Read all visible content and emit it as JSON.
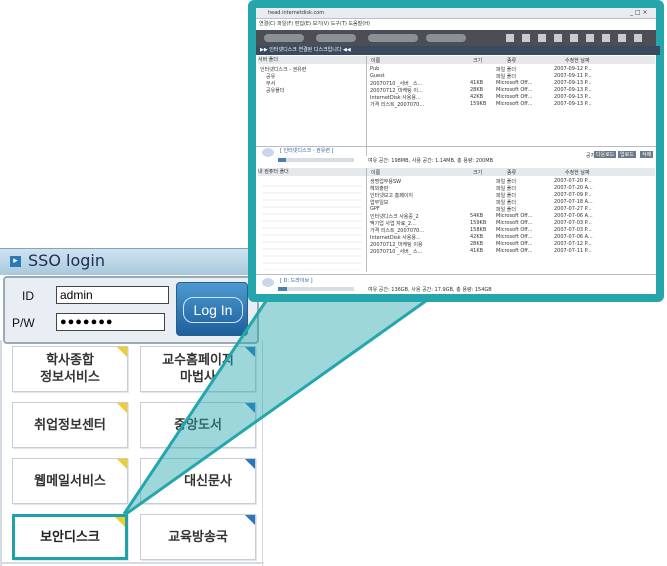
{
  "sso": {
    "title": "SSO login",
    "id_label": "ID",
    "pw_label": "P/W",
    "id_value": "admin",
    "pw_value": "●●●●●●●",
    "login_label": "Log In"
  },
  "tiles": [
    {
      "line1": "학사종합",
      "line2": "정보서비스"
    },
    {
      "line1": "교수홈페이지",
      "line2": "마법사"
    },
    {
      "line1": "취업정보센터",
      "line2": ""
    },
    {
      "line1": "중앙도서",
      "line2": ""
    },
    {
      "line1": "웹메일서비스",
      "line2": ""
    },
    {
      "line1": "대신문사",
      "line2": ""
    },
    {
      "line1": "보안디스크",
      "line2": ""
    },
    {
      "line1": "교육방송국",
      "line2": ""
    }
  ],
  "window": {
    "title": "head.internetdisk.com",
    "menu": "연결(C)  파일(F)  편집(E)  보기(V)  도구(T)  도움말(H)",
    "section_title": "▶▶ 인터넷디스크 연결된 디스크입니다 ◀◀",
    "server_folder": "서버 폴더",
    "col_name": "이름",
    "col_size": "크기",
    "col_type": "종류",
    "col_date": "수정한 날짜",
    "tree_top": [
      "인터넷디스크 - 권유련",
      "공유",
      "부서",
      "공유폴더"
    ],
    "files_top": [
      {
        "name": "Pub",
        "size": "",
        "type": "파일 폴더",
        "date": "2007-09-12 P..."
      },
      {
        "name": "Guest",
        "size": "",
        "type": "파일 폴더",
        "date": "2007-09-11 P..."
      },
      {
        "name": "20070710 _서버_ 스...",
        "size": "41KB",
        "type": "Microsoft Off...",
        "date": "2007-09-13 P..."
      },
      {
        "name": "20070712_마케팅 이...",
        "size": "28KB",
        "type": "Microsoft Off...",
        "date": "2007-09-13 P..."
      },
      {
        "name": "InternetDisk 사용용...",
        "size": "42KB",
        "type": "Microsoft Off...",
        "date": "2007-09-13 P..."
      },
      {
        "name": "가격 리스트_2007070...",
        "size": "159KB",
        "type": "Microsoft Off...",
        "date": "2007-09-13 P..."
      }
    ],
    "disk_top": "[ 인터넷디스크 - 권유련 ]",
    "space_top": "여유 공간: 198MB,  사용 공간: 1.14MB,  총 용량: 200MB",
    "my_folder": "내 컴퓨터 폴더",
    "files_bottom": [
      {
        "name": "생명업무용SW",
        "size": "",
        "type": "파일 폴더",
        "date": "2007-07-20 P..."
      },
      {
        "name": "헤외출판",
        "size": "",
        "type": "파일 폴더",
        "date": "2007-07-20 A..."
      },
      {
        "name": "인터넷보고 홈페이지",
        "size": "",
        "type": "파일 폴더",
        "date": "2007-07-09 P..."
      },
      {
        "name": "업무일보",
        "size": "",
        "type": "파일 폴더",
        "date": "2007-07-18 A..."
      },
      {
        "name": "GPF",
        "size": "",
        "type": "파일 폴더",
        "date": "2007-07-27 P..."
      },
      {
        "name": "인터넷디스크 사용중_2",
        "size": "54KB",
        "type": "Microsoft Off...",
        "date": "2007-07-06 A..."
      },
      {
        "name": "맥기업 사업 자료_2...",
        "size": "159KB",
        "type": "Microsoft Off...",
        "date": "2007-07-03 P..."
      },
      {
        "name": "가격 리스트_2007070...",
        "size": "158KB",
        "type": "Microsoft Off...",
        "date": "2007-07-03 P..."
      },
      {
        "name": "InternetDisk 사용용...",
        "size": "42KB",
        "type": "Microsoft Off...",
        "date": "2007-07-06 A..."
      },
      {
        "name": "20070712_마케팅 이용",
        "size": "28KB",
        "type": "Microsoft Off...",
        "date": "2007-07-12 P..."
      },
      {
        "name": "20070710 _서버_ 스...",
        "size": "41KB",
        "type": "Microsoft Off...",
        "date": "2007-07-11 P..."
      }
    ],
    "disk_bottom": "[ D: 드라이브 ]",
    "space_bottom": "여유 공간: 136GB,  사용 공간: 17.9GB,  총 용량: 154GB",
    "quota_label": "공지",
    "buttons": [
      "다운로드",
      "업로드",
      "삭제"
    ]
  },
  "colors": {
    "teal": "#25a6ad",
    "tile_yellow": "#f1cc2c",
    "tile_blue": "#2a74c4"
  }
}
